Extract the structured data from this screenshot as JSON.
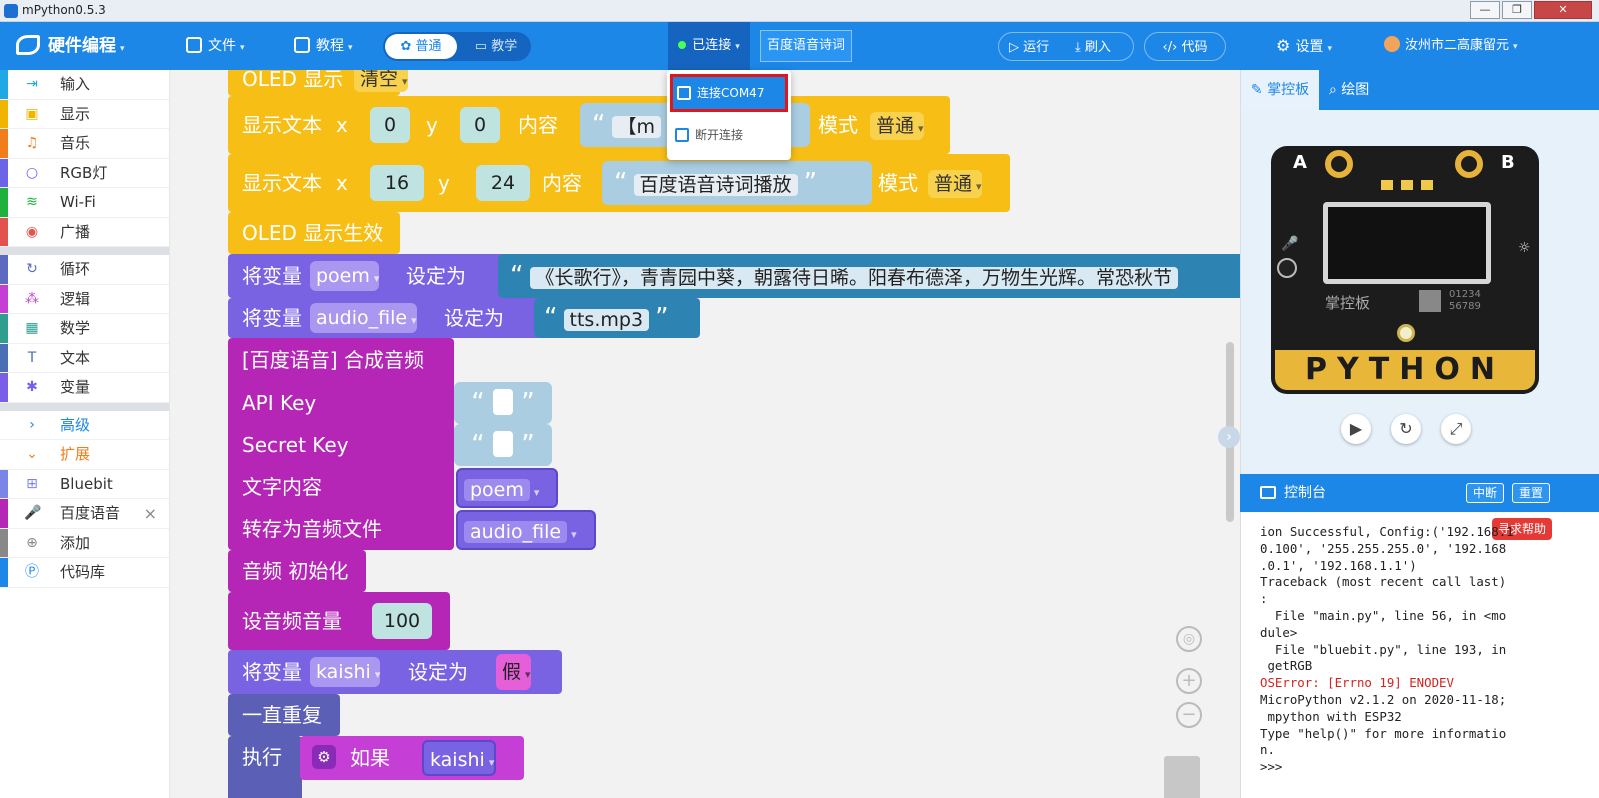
{
  "window": {
    "title": "mPython0.5.3",
    "minimize": "—",
    "restore": "❐",
    "close": "✕"
  },
  "topbar": {
    "app_name": "硬件编程",
    "file": "文件",
    "tutorial": "教程",
    "mode_normal": "普通",
    "mode_teach": "教学",
    "connection": "已连接",
    "project_name": "百度语音诗词",
    "run": "运行",
    "flash": "刷入",
    "code": "代码",
    "settings": "设置",
    "user": "汝州市二高康留元"
  },
  "dropdown": {
    "connect": "连接COM47",
    "disconnect": "断开连接"
  },
  "sidebar": {
    "items": [
      {
        "label": "输入",
        "color": "#1ea8e6",
        "icon": "⇥"
      },
      {
        "label": "显示",
        "color": "#f1b400",
        "icon": "▣"
      },
      {
        "label": "音乐",
        "color": "#f27e1b",
        "icon": "♫"
      },
      {
        "label": "RGB灯",
        "color": "#6b63e8",
        "icon": "○"
      },
      {
        "label": "Wi-Fi",
        "color": "#1fb13c",
        "icon": "≋"
      },
      {
        "label": "广播",
        "color": "#e2534f",
        "icon": "◉"
      }
    ],
    "items2": [
      {
        "label": "循环",
        "color": "#5c6bc0",
        "icon": "↻"
      },
      {
        "label": "逻辑",
        "color": "#c53fd6",
        "icon": "⁂"
      },
      {
        "label": "数学",
        "color": "#2e9e8f",
        "icon": "▦"
      },
      {
        "label": "文本",
        "color": "#4a6fb5",
        "icon": "T"
      },
      {
        "label": "变量",
        "color": "#7a5ee8",
        "icon": "✱"
      }
    ],
    "advanced": "高级",
    "extend": "扩展",
    "items3": [
      {
        "label": "Bluebit",
        "color": "#7a85e8",
        "icon": "⊞"
      },
      {
        "label": "百度语音",
        "color": "#b526b7",
        "icon": "🎤"
      },
      {
        "label": "添加",
        "color": "#888888",
        "icon": "⊕"
      },
      {
        "label": "代码库",
        "color": "#1d87e8",
        "icon": "Ⓟ"
      }
    ],
    "close_x": "×"
  },
  "blocks": {
    "oled_clear": "OLED 显示",
    "oled_clear_mode": "清空",
    "show1": "显示文本",
    "x": "x",
    "y": "y",
    "content": "内容",
    "mode": "模式",
    "show1_x": "0",
    "show1_y": "0",
    "show1_text": "【m",
    "show1_mode": "普通",
    "show2_x": "16",
    "show2_y": "24",
    "show2_text": "百度语音诗词播放",
    "show2_mode": "普通",
    "oled_show": "OLED 显示生效",
    "setvar": "将变量",
    "setto": "设定为",
    "var_poem": "poem",
    "poem_text": "《长歌行》，青青园中葵，朝露待日晞。阳春布德泽，万物生光辉。常恐秋节",
    "var_audio": "audio_file",
    "audio_text": "tts.mp3",
    "tts_title": "[百度语音] 合成音频",
    "api_key": "API Key",
    "secret_key": "Secret Key",
    "text_content": "文字内容",
    "save_as": "转存为音频文件",
    "audio_init": "音频 初始化",
    "volume": "设音频音量",
    "volume_val": "100",
    "var_kaishi": "kaishi",
    "false_val": "假",
    "forever": "一直重复",
    "do": "执行",
    "if": "如果",
    "quote_open": "“",
    "quote_close": "”"
  },
  "panel": {
    "tab_board": "掌控板",
    "tab_draw": "绘图",
    "board_a": "A",
    "board_b": "B",
    "board_brand": "掌控板",
    "board_digits": "01234\n56789",
    "board_python": "PYTHON"
  },
  "console": {
    "title": "控制台",
    "interrupt": "中断",
    "reset": "重置",
    "help": "寻求帮助",
    "lines": [
      "ion Successful, Config:('192.168.1",
      "0.100', '255.255.255.0', '192.168",
      ".0.1', '192.168.1.1')",
      "Traceback (most recent call last)",
      ":",
      "  File \"main.py\", line 56, in <mo",
      "dule>",
      "  File \"bluebit.py\", line 193, in",
      " getRGB"
    ],
    "error_line": "OSError: [Errno 19] ENODEV",
    "lines2": [
      "MicroPython v2.1.2 on 2020-11-18;",
      " mpython with ESP32",
      "Type \"help()\" for more informatio",
      "n.",
      ">>>"
    ]
  }
}
